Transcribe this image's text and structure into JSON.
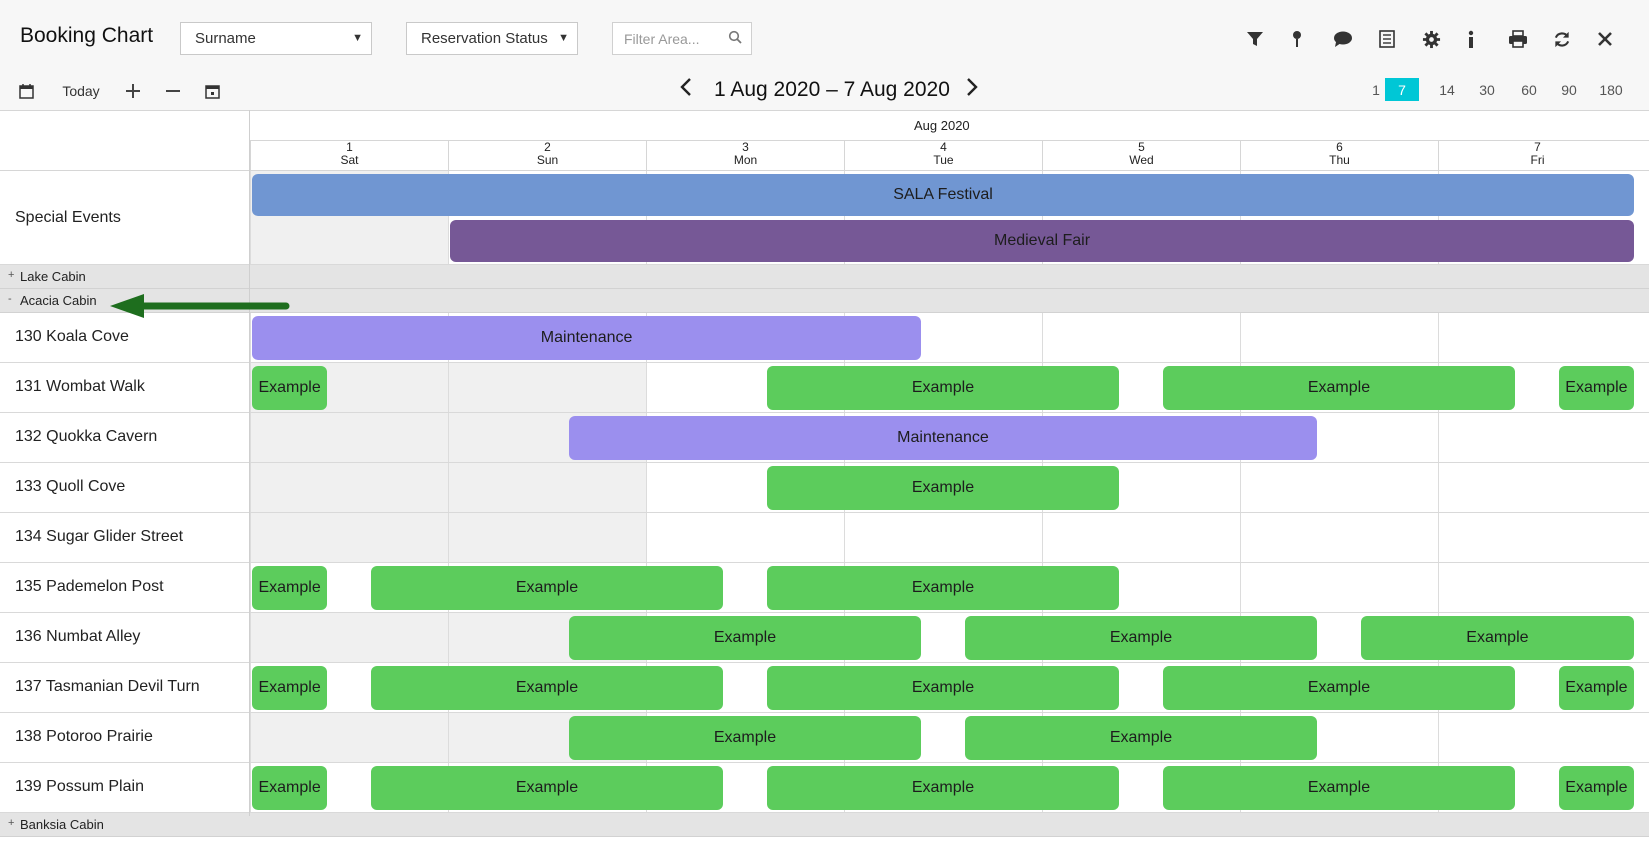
{
  "header": {
    "title": "Booking Chart",
    "sort_select": "Surname",
    "status_select": "Reservation Status",
    "search_placeholder": "Filter Area...",
    "icons": [
      "filter-icon",
      "pin-icon",
      "comment-icon",
      "list-icon",
      "gear-icon",
      "info-icon",
      "print-icon",
      "refresh-icon",
      "close-icon"
    ]
  },
  "toolbar": {
    "today_label": "Today",
    "date_range": "1 Aug 2020 – 7 Aug 2020",
    "zoom_levels": [
      "1",
      "7",
      "14",
      "30",
      "60",
      "90",
      "180"
    ],
    "zoom_selected": "7",
    "accent_color": "#00c7d6"
  },
  "calendar": {
    "month": "Aug 2020",
    "days": [
      {
        "num": "1",
        "dow": "Sat"
      },
      {
        "num": "2",
        "dow": "Sun"
      },
      {
        "num": "3",
        "dow": "Mon"
      },
      {
        "num": "4",
        "dow": "Tue"
      },
      {
        "num": "5",
        "dow": "Wed"
      },
      {
        "num": "6",
        "dow": "Thu"
      },
      {
        "num": "7",
        "dow": "Fri"
      }
    ]
  },
  "special_events": {
    "label": "Special Events",
    "events": [
      {
        "name": "SALA Festival",
        "start": 0,
        "end": 7,
        "lane": 0,
        "color": "blue"
      },
      {
        "name": "Medieval Fair",
        "start": 1,
        "end": 7,
        "lane": 1,
        "color": "darkpurple"
      }
    ]
  },
  "groups": [
    {
      "label": "Lake Cabin",
      "toggle": "+"
    },
    {
      "label": "Acacia Cabin",
      "toggle": "-"
    },
    {
      "label": "Banksia Cabin",
      "toggle": "+"
    }
  ],
  "rooms": [
    {
      "label": "130 Koala Cove",
      "shade": [],
      "bookings": [
        {
          "text": "Maintenance",
          "start": 0,
          "end": 3.4,
          "color": "purple"
        }
      ]
    },
    {
      "label": "131 Wombat Walk",
      "shade": [
        0,
        1
      ],
      "bookings": [
        {
          "text": "Example",
          "start": 0,
          "end": 0.4,
          "color": "green"
        },
        {
          "text": "Example",
          "start": 2.6,
          "end": 4.4,
          "color": "green"
        },
        {
          "text": "Example",
          "start": 4.6,
          "end": 6.4,
          "color": "green"
        },
        {
          "text": "Example",
          "start": 6.6,
          "end": 7,
          "color": "green"
        }
      ]
    },
    {
      "label": "132 Quokka Cavern",
      "shade": [
        0,
        1
      ],
      "bookings": [
        {
          "text": "Maintenance",
          "start": 1.6,
          "end": 5.4,
          "color": "purple"
        }
      ]
    },
    {
      "label": "133 Quoll Cove",
      "shade": [
        0,
        1
      ],
      "bookings": [
        {
          "text": "Example",
          "start": 2.6,
          "end": 4.4,
          "color": "green"
        }
      ]
    },
    {
      "label": "134 Sugar Glider Street",
      "shade": [
        0,
        1
      ],
      "bookings": []
    },
    {
      "label": "135 Pademelon Post",
      "shade": [],
      "bookings": [
        {
          "text": "Example",
          "start": 0,
          "end": 0.4,
          "color": "green"
        },
        {
          "text": "Example",
          "start": 0.6,
          "end": 2.4,
          "color": "green"
        },
        {
          "text": "Example",
          "start": 2.6,
          "end": 4.4,
          "color": "green"
        }
      ]
    },
    {
      "label": "136 Numbat Alley",
      "shade": [
        0,
        1
      ],
      "bookings": [
        {
          "text": "Example",
          "start": 1.6,
          "end": 3.4,
          "color": "green"
        },
        {
          "text": "Example",
          "start": 3.6,
          "end": 5.4,
          "color": "green"
        },
        {
          "text": "Example",
          "start": 5.6,
          "end": 7,
          "color": "green"
        }
      ]
    },
    {
      "label": "137 Tasmanian Devil Turn",
      "shade": [],
      "bookings": [
        {
          "text": "Example",
          "start": 0,
          "end": 0.4,
          "color": "green"
        },
        {
          "text": "Example",
          "start": 0.6,
          "end": 2.4,
          "color": "green"
        },
        {
          "text": "Example",
          "start": 2.6,
          "end": 4.4,
          "color": "green"
        },
        {
          "text": "Example",
          "start": 4.6,
          "end": 6.4,
          "color": "green"
        },
        {
          "text": "Example",
          "start": 6.6,
          "end": 7,
          "color": "green"
        }
      ]
    },
    {
      "label": "138 Potoroo Prairie",
      "shade": [
        0,
        1
      ],
      "bookings": [
        {
          "text": "Example",
          "start": 1.6,
          "end": 3.4,
          "color": "green"
        },
        {
          "text": "Example",
          "start": 3.6,
          "end": 5.4,
          "color": "green"
        }
      ]
    },
    {
      "label": "139 Possum Plain",
      "shade": [],
      "bookings": [
        {
          "text": "Example",
          "start": 0,
          "end": 0.4,
          "color": "green"
        },
        {
          "text": "Example",
          "start": 0.6,
          "end": 2.4,
          "color": "green"
        },
        {
          "text": "Example",
          "start": 2.6,
          "end": 4.4,
          "color": "green"
        },
        {
          "text": "Example",
          "start": 4.6,
          "end": 6.4,
          "color": "green"
        },
        {
          "text": "Example",
          "start": 6.6,
          "end": 7,
          "color": "green"
        }
      ]
    }
  ]
}
